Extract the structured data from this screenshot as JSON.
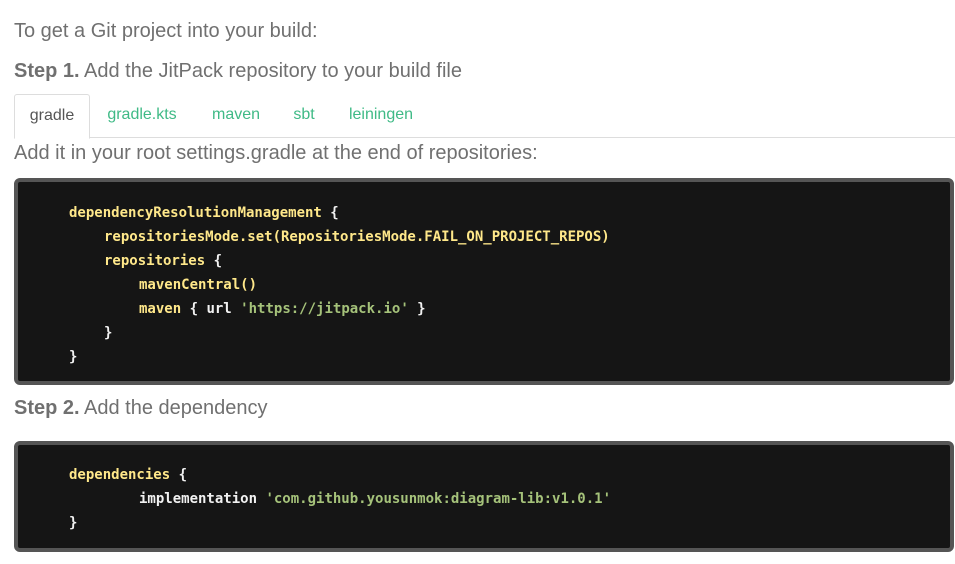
{
  "intro": "To get a Git project into your build:",
  "step1": {
    "label": "Step 1.",
    "text": " Add the JitPack repository to your build file"
  },
  "tabs": [
    {
      "label": "gradle",
      "active": true
    },
    {
      "label": "gradle.kts",
      "active": false
    },
    {
      "label": "maven",
      "active": false
    },
    {
      "label": "sbt",
      "active": false
    },
    {
      "label": "leiningen",
      "active": false
    }
  ],
  "note": "Add it in your root settings.gradle at the end of repositories:",
  "code1": {
    "l1_kw": "dependencyResolutionManagement",
    "l1_rest": " {",
    "l2_kw": "repositoriesMode.set(RepositoriesMode.FAIL_ON_PROJECT_REPOS)",
    "l3_kw": "repositories",
    "l3_rest": " {",
    "l4_kw": "mavenCentral()",
    "l5_kw": "maven",
    "l5_mid": " { url ",
    "l5_str": "'https://jitpack.io'",
    "l5_end": " }",
    "l6": "}",
    "l7": "}"
  },
  "step2": {
    "label": "Step 2.",
    "text": " Add the dependency"
  },
  "code2": {
    "l1_kw": "dependencies",
    "l1_rest": " {",
    "l2_pl": "implementation",
    "l2_str": " 'com.github.yousunmok:diagram-lib:v1.0.1'",
    "l3": "}"
  },
  "colors": {
    "tab_link": "#3fba86",
    "code_bg": "#151515",
    "code_border": "#555555",
    "keyword": "#ffe88a",
    "string": "#a5c27a"
  }
}
